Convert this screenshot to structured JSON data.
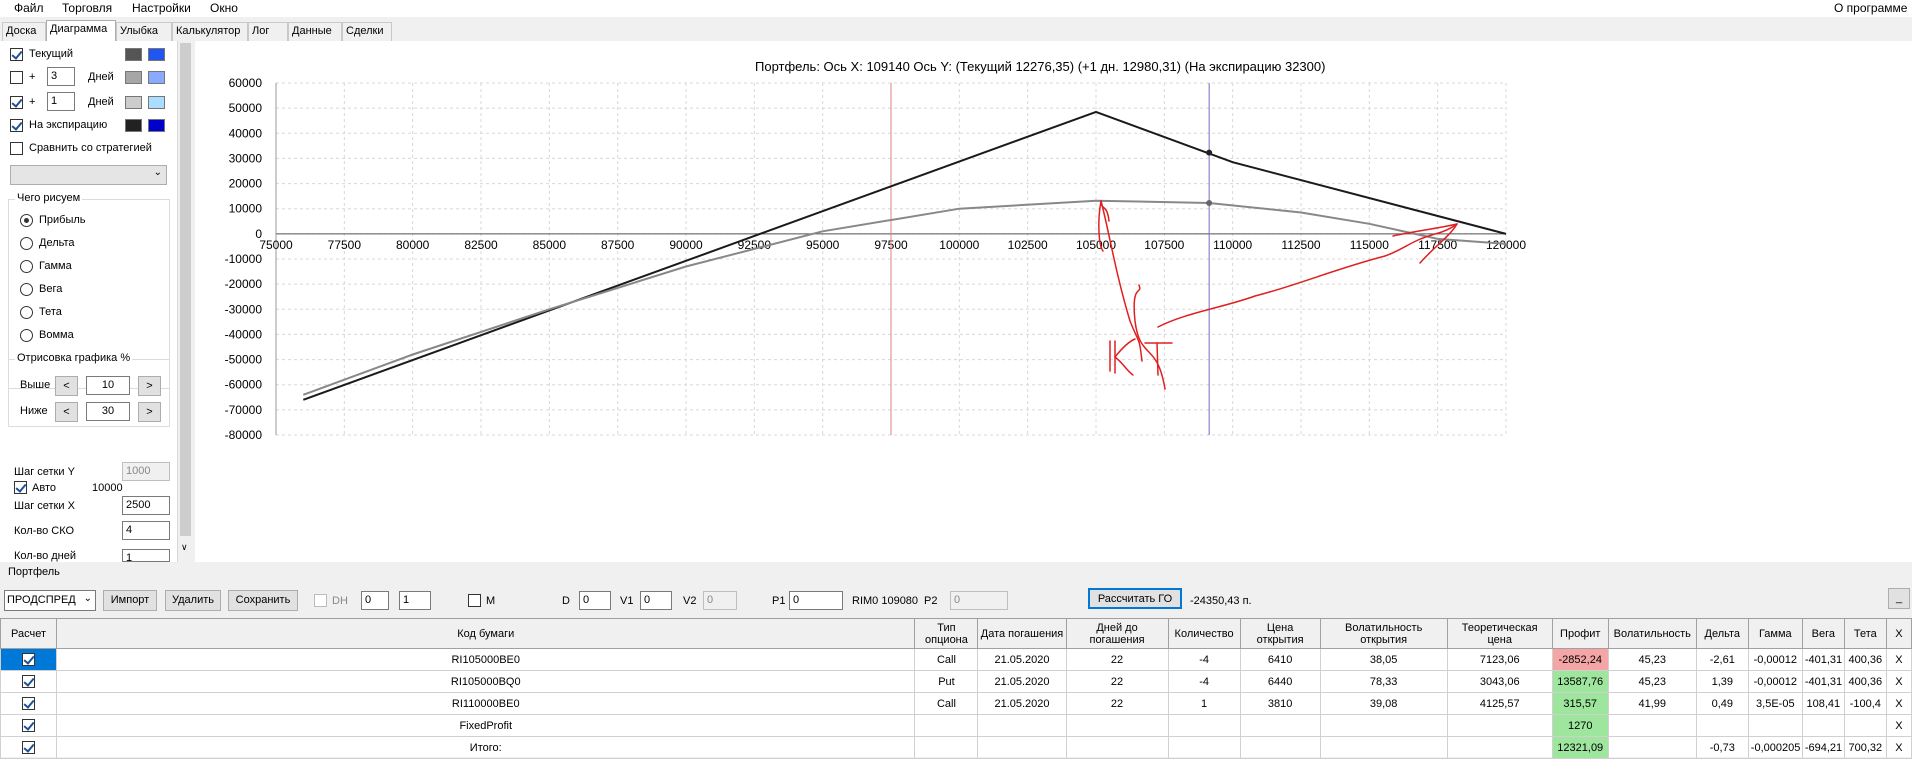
{
  "menu": {
    "file": "Файл",
    "trading": "Торговля",
    "settings": "Настройки",
    "window": "Окно",
    "about": "О программе"
  },
  "tabs": [
    "Доска",
    "Диаграмма",
    "Улыбка",
    "Калькулятор",
    "Лог",
    "Данные",
    "Сделки"
  ],
  "left_panel": {
    "current_label": "Текущий",
    "plus_label": "+",
    "days_label": "Дней",
    "days_value_1": "3",
    "days_value_2": "1",
    "expiration_label": "На экспирацию",
    "compare_label": "Сравнить со стратегией",
    "compare_select_value": "",
    "what_group_title": "Чего рисуем",
    "radio_options": [
      "Прибыль",
      "Дельта",
      "Гамма",
      "Вега",
      "Тета",
      "Вомма"
    ],
    "selected_radio": "Прибыль",
    "render_group_title": "Отрисовка графика %",
    "above_label": "Выше",
    "above_value": "10",
    "below_label": "Ниже",
    "below_value": "30",
    "btn_less": "<",
    "btn_more": ">",
    "grid_y_label": "Шаг сетки Y",
    "grid_y_value": "1000",
    "auto_label": "Авто",
    "auto_value": "10000",
    "grid_x_label": "Шаг сетки X",
    "grid_x_value": "2500",
    "sko_label": "Кол-во СКО",
    "sko_value": "4",
    "days_per_label": "Кол-во дней",
    "days_per_value": "1",
    "colors": {
      "current_a": "#555555",
      "current_b": "#2255ee",
      "plus3_a": "#a6a6a6",
      "plus3_b": "#88aaff",
      "plus1_a": "#cccccc",
      "plus1_b": "#aaddff",
      "exp_a": "#222222",
      "exp_b": "#0000cc"
    }
  },
  "chart_data": {
    "type": "line",
    "title": "Портфель:  Ось X:  109140  Ось Y:   (Текущий 12276,35)   (+1 дн.  12980,31)   (На экспирацию 32300)",
    "xlim": [
      75000,
      120000
    ],
    "ylim": [
      -80000,
      60000
    ],
    "x_ticks": [
      "75000",
      "77500",
      "80000",
      "82500",
      "85000",
      "87500",
      "90000",
      "92500",
      "95000",
      "97500",
      "100000",
      "102500",
      "105000",
      "107500",
      "110000",
      "112500",
      "115000",
      "117500",
      "120000"
    ],
    "y_ticks": [
      "60000",
      "50000",
      "40000",
      "30000",
      "20000",
      "10000",
      "0",
      "-10000",
      "-20000",
      "-30000",
      "-40000",
      "-50000",
      "-60000",
      "-70000",
      "-80000"
    ],
    "grid": true,
    "vlines": [
      {
        "x": 97500,
        "color": "#e08080"
      },
      {
        "x": 109140,
        "color": "#7070c0"
      }
    ],
    "series": [
      {
        "color": "#1a1a1a",
        "x": [
          76000,
          105000,
          110000,
          120000
        ],
        "y": [
          -66000,
          48500,
          28500,
          0
        ]
      },
      {
        "color": "#888888",
        "x": [
          76000,
          80000,
          85000,
          90000,
          95000,
          100000,
          105000,
          109140,
          112500,
          115000,
          117500,
          120000
        ],
        "y": [
          -64000,
          -48000,
          -30000,
          -13000,
          1000,
          10000,
          13200,
          12276,
          8500,
          4000,
          -2000,
          -4000
        ]
      }
    ],
    "markers": [
      {
        "x": 109140,
        "y": 32300,
        "color": "#222222"
      },
      {
        "x": 109140,
        "y": 12276,
        "color": "#666666"
      }
    ],
    "annotation_text": "КТ"
  },
  "portfolio": {
    "section_label": "Портфель",
    "strategy_select": "ПРОДСПРЕД",
    "import_btn": "Импорт",
    "delete_btn": "Удалить",
    "save_btn": "Сохранить",
    "dh_label": "DH",
    "dh_value_1": "0",
    "dh_value_2": "1",
    "m_label": "M",
    "d_label": "D",
    "d_value": "0",
    "v1_label": "V1",
    "v1_value": "0",
    "v2_label": "V2",
    "v2_value": "0",
    "p1_label": "P1",
    "p1_value": "0",
    "rim_label": "RIM0 109080",
    "p2_label": "P2",
    "p2_value": "0",
    "calc_btn": "Рассчитать ГО",
    "go_value": "-24350,43 п.",
    "min_btn": "_"
  },
  "table": {
    "headers": [
      "Расчет",
      "Код бумаги",
      "Тип опциона",
      "Дата погашения",
      "Дней до погашения",
      "Количество",
      "Цена открытия",
      "Волатильность открытия",
      "Теоретическая цена",
      "Профит",
      "Волатильность",
      "Дельта",
      "Гамма",
      "Вега",
      "Тета",
      "X"
    ],
    "rows": [
      [
        "",
        "RI105000BE0",
        "Call",
        "21.05.2020",
        "22",
        "-4",
        "6410",
        "38,05",
        "7123,06",
        "-2852,24",
        "45,23",
        "-2,61",
        "-0,00012",
        "-401,31",
        "400,36",
        "X"
      ],
      [
        "",
        "RI105000BQ0",
        "Put",
        "21.05.2020",
        "22",
        "-4",
        "6440",
        "78,33",
        "3043,06",
        "13587,76",
        "45,23",
        "1,39",
        "-0,00012",
        "-401,31",
        "400,36",
        "X"
      ],
      [
        "",
        "RI110000BE0",
        "Call",
        "21.05.2020",
        "22",
        "1",
        "3810",
        "39,08",
        "4125,57",
        "315,57",
        "41,99",
        "0,49",
        "3,5E-05",
        "108,41",
        "-100,4",
        "X"
      ],
      [
        "",
        "FixedProfit",
        "",
        "",
        "",
        "",
        "",
        "",
        "",
        "1270",
        "",
        "",
        "",
        "",
        "",
        "X"
      ],
      [
        "",
        "Итого:",
        "",
        "",
        "",
        "",
        "",
        "",
        "",
        "12321,09",
        "",
        "-0,73",
        "-0,000205",
        "-694,21",
        "700,32",
        "X"
      ]
    ]
  }
}
